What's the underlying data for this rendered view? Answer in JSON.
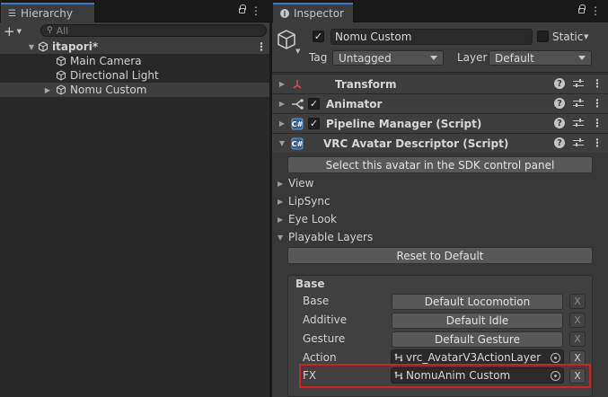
{
  "hierarchy": {
    "tab_label": "Hierarchy",
    "search_placeholder": "All",
    "scene_name": "itapori*",
    "items": [
      {
        "label": "Main Camera"
      },
      {
        "label": "Directional Light"
      },
      {
        "label": "Nomu Custom"
      }
    ]
  },
  "inspector": {
    "tab_label": "Inspector",
    "object_name": "Nomu Custom",
    "static_label": "Static",
    "tag_label": "Tag",
    "tag_value": "Untagged",
    "layer_label": "Layer",
    "layer_value": "Default",
    "components": [
      {
        "label": "Transform"
      },
      {
        "label": "Animator"
      },
      {
        "label": "Pipeline Manager (Script)"
      },
      {
        "label": "VRC Avatar Descriptor (Script)"
      }
    ],
    "select_avatar_button": "Select this avatar in the SDK control panel",
    "foldouts": [
      {
        "label": "View"
      },
      {
        "label": "LipSync"
      },
      {
        "label": "Eye Look"
      },
      {
        "label": "Playable Layers"
      }
    ],
    "reset_button": "Reset to Default",
    "base_header": "Base",
    "layers": [
      {
        "label": "Base",
        "value": "Default Locomotion",
        "clear": "X"
      },
      {
        "label": "Additive",
        "value": "Default Idle",
        "clear": "X"
      },
      {
        "label": "Gesture",
        "value": "Default Gesture",
        "clear": "X"
      },
      {
        "label": "Action",
        "value": "vrc_AvatarV3ActionLayer",
        "clear": "X"
      },
      {
        "label": "FX",
        "value": "NomuAnim Custom",
        "clear": "X"
      }
    ]
  },
  "colors": {
    "tab_accent": "#3a79bb",
    "highlight_box": "#e01b1b"
  }
}
